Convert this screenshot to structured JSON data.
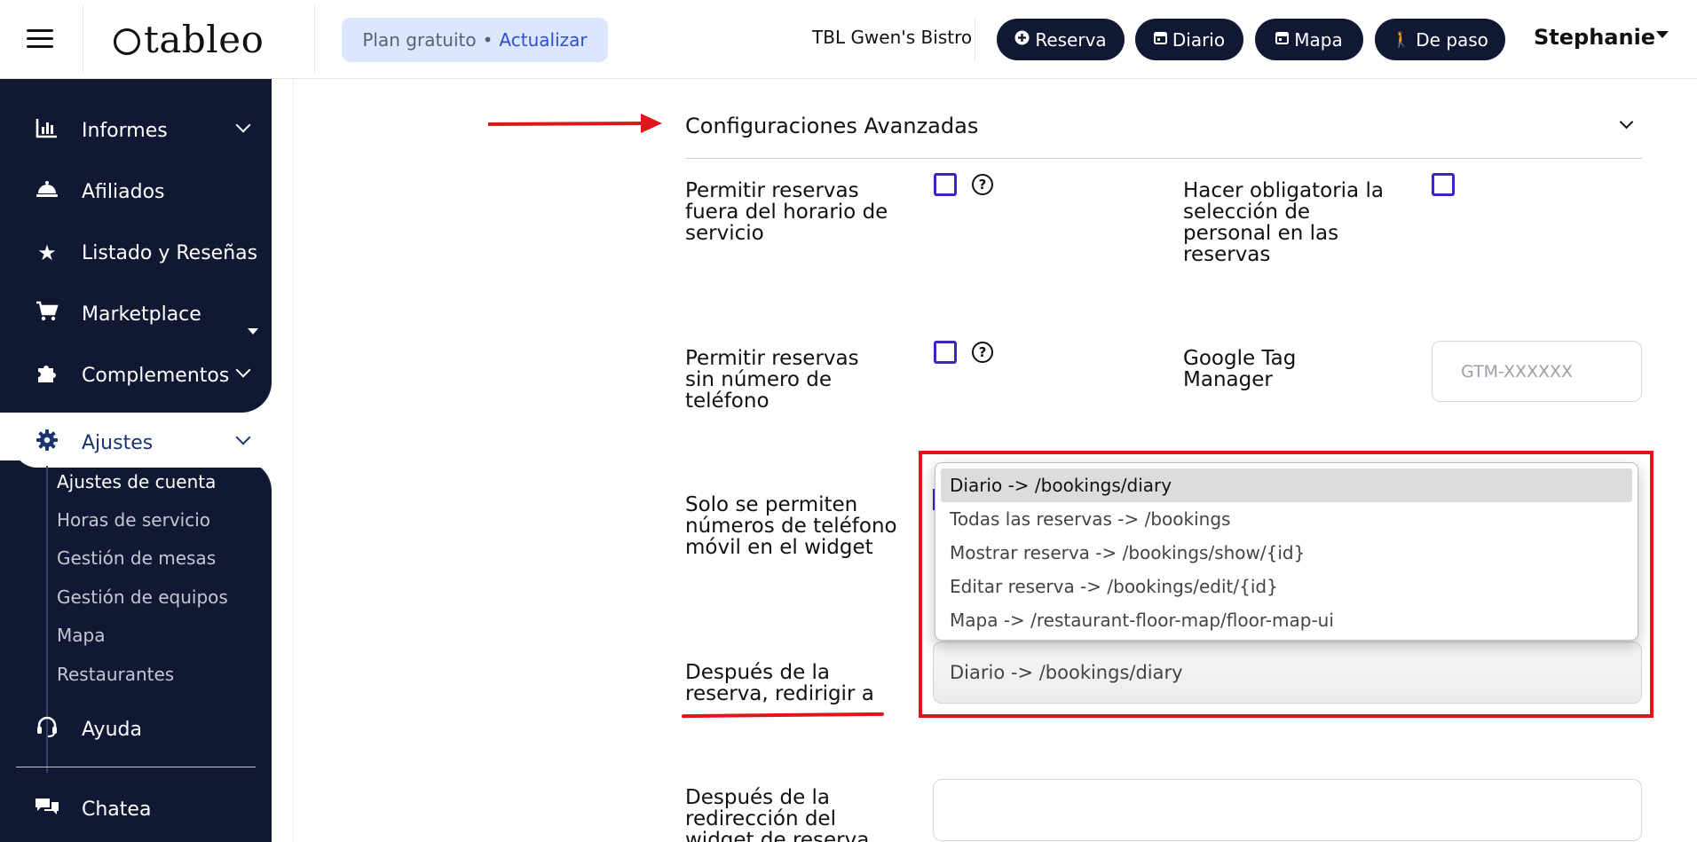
{
  "header": {
    "logo_text": "tableo",
    "plan_label": "Plan gratuito",
    "plan_separator": "•",
    "upgrade_label": "Actualizar",
    "restaurant_name": "TBL Gwen's Bistro",
    "buttons": [
      {
        "label": "Reserva",
        "icon": "plus-circle-icon"
      },
      {
        "label": "Diario",
        "icon": "calendar-icon"
      },
      {
        "label": "Mapa",
        "icon": "calendar-icon"
      },
      {
        "label": "De paso",
        "icon": "walking-icon"
      }
    ],
    "user_name": "Stephanie"
  },
  "sidebar": {
    "items": [
      {
        "label": "Informes",
        "icon": "bar-chart-icon",
        "expandable": true
      },
      {
        "label": "Afiliados",
        "icon": "service-bell-icon",
        "expandable": false
      },
      {
        "label": "Listado y Reseñas",
        "icon": "star-icon",
        "expandable": true
      },
      {
        "label": "Marketplace",
        "icon": "cart-icon",
        "expandable": false
      },
      {
        "label": "Complementos",
        "icon": "puzzle-icon",
        "expandable": true
      },
      {
        "label": "Ajustes",
        "icon": "gear-icon",
        "expandable": true,
        "active": true
      },
      {
        "label": "Ayuda",
        "icon": "headset-icon",
        "expandable": false
      },
      {
        "label": "Chatea",
        "icon": "chat-icon",
        "expandable": false
      }
    ],
    "subitems": [
      {
        "label": "Ajustes de cuenta",
        "current": true
      },
      {
        "label": "Horas de servicio"
      },
      {
        "label": "Gestión de mesas"
      },
      {
        "label": "Gestión de equipos"
      },
      {
        "label": "Mapa"
      },
      {
        "label": "Restaurantes"
      }
    ]
  },
  "main": {
    "section_title": "Configuraciones Avanzadas",
    "fields": {
      "out_of_hours": {
        "label": "Permitir reservas fuera del horario de servicio",
        "checked": false
      },
      "staff_required": {
        "label": "Hacer obligatoria la selección de personal en las reservas",
        "checked": false
      },
      "no_phone": {
        "label": "Permitir reservas sin número de teléfono",
        "checked": false
      },
      "gtm": {
        "label": "Google Tag Manager",
        "value": "",
        "placeholder": "GTM-XXXXXX"
      },
      "mobile_only": {
        "label": "Solo se permiten números de teléfono móvil en el widget"
      },
      "redirect": {
        "label": "Después de la reserva, redirigir a",
        "selected": "Diario -> /bookings/diary",
        "options": [
          "Diario -> /bookings/diary",
          "Todas las reservas -> /bookings",
          "Mostrar reserva -> /bookings/show/{id}",
          "Editar reserva -> /bookings/edit/{id}",
          "Mapa -> /restaurant-floor-map/floor-map-ui"
        ]
      },
      "widget_redirect": {
        "label": "Después de la redirección del widget de reserva",
        "value": ""
      }
    }
  },
  "colors": {
    "navy": "#101833",
    "checkbox_border": "#3d22c4",
    "annotation_red": "#e0161c",
    "plan_pill_bg": "#dde6ff",
    "upgrade_link": "#2c4fd6"
  }
}
